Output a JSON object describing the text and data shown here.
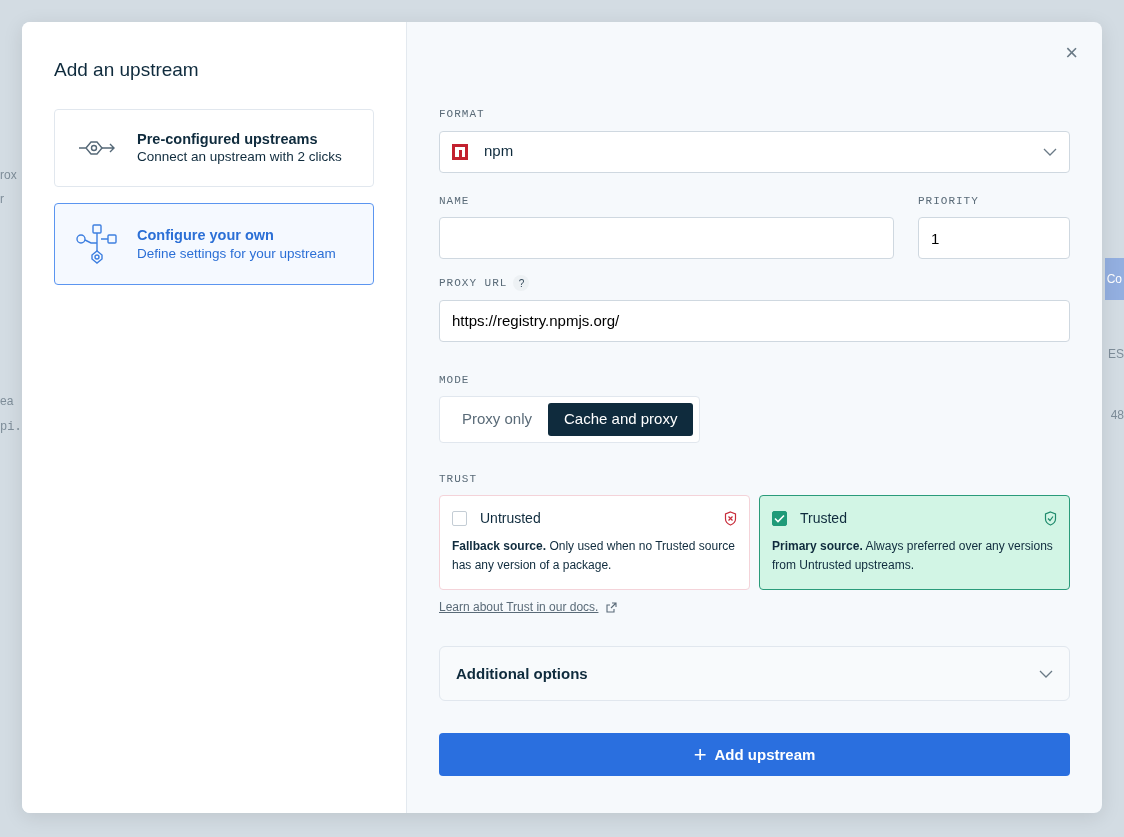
{
  "background": {
    "fragments": [
      {
        "text": "rox"
      },
      {
        "text": "r"
      },
      {
        "text": "ea"
      },
      {
        "text": "pi."
      },
      {
        "text": "Co",
        "kind": "button"
      },
      {
        "text": "ES"
      },
      {
        "text": "48"
      }
    ]
  },
  "dialog": {
    "title": "Add an upstream",
    "close": "×",
    "options": [
      {
        "kind": "preconfigured",
        "title": "Pre-configured upstreams",
        "subtitle": "Connect an upstream with 2 clicks",
        "selected": false
      },
      {
        "kind": "custom",
        "title": "Configure your own",
        "subtitle": "Define settings for your upstream",
        "selected": true
      }
    ]
  },
  "form": {
    "format": {
      "label": "FORMAT",
      "value": "npm"
    },
    "name": {
      "label": "NAME"
    },
    "priority": {
      "label": "PRIORITY",
      "value": "1"
    },
    "proxy_url": {
      "label": "PROXY URL",
      "help": "?",
      "value": "https://registry.npmjs.org/"
    },
    "mode": {
      "label": "MODE",
      "options": [
        {
          "label": "Proxy only",
          "selected": false
        },
        {
          "label": "Cache and proxy",
          "selected": true
        }
      ]
    },
    "trust": {
      "label": "TRUST",
      "options": [
        {
          "kind": "untrusted",
          "title": "Untrusted",
          "description": "**Fallback source.** Only used when no Trusted source has any version of a package.",
          "checked": false
        },
        {
          "kind": "trusted",
          "title": "Trusted",
          "description": "**Primary source.** Always preferred over any versions from Untrusted upstreams.",
          "checked": true
        }
      ],
      "docs_link": "Learn about Trust in our docs."
    },
    "additional_options": {
      "label": "Additional options",
      "expanded": false
    },
    "submit": {
      "icon": "+",
      "label": "Add upstream"
    }
  }
}
